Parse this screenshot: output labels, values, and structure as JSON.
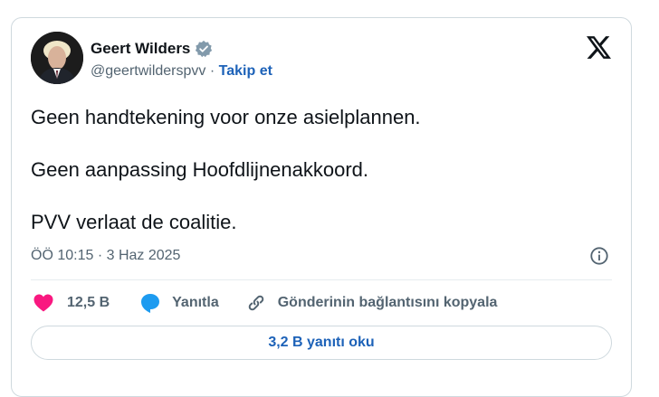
{
  "author": {
    "name": "Geert Wilders",
    "handle": "@geertwilderspvv",
    "separator": "·",
    "follow_label": "Takip et"
  },
  "tweet": {
    "lines": [
      "Geen handtekening voor onze asielplannen.",
      "Geen aanpassing Hoofdlijnenakkoord.",
      "PVV verlaat de coalitie."
    ],
    "timestamp": "ÖÖ 10:15 · 3 Haz 2025"
  },
  "actions": {
    "likes_count": "12,5 B",
    "reply_label": "Yanıtla",
    "copy_link_label": "Gönderinin bağlantısını kopyala"
  },
  "read_replies_label": "3,2 B yanıtı oku",
  "icons": {
    "verified": "verified-badge-icon",
    "platform": "x-logo-icon",
    "info": "info-icon",
    "like": "heart-icon",
    "reply": "speech-bubble-icon",
    "copy": "link-icon"
  },
  "colors": {
    "link_blue": "#1d62b8",
    "like_pink": "#f91880",
    "reply_blue": "#1d9bf0",
    "muted_gray": "#536471"
  }
}
